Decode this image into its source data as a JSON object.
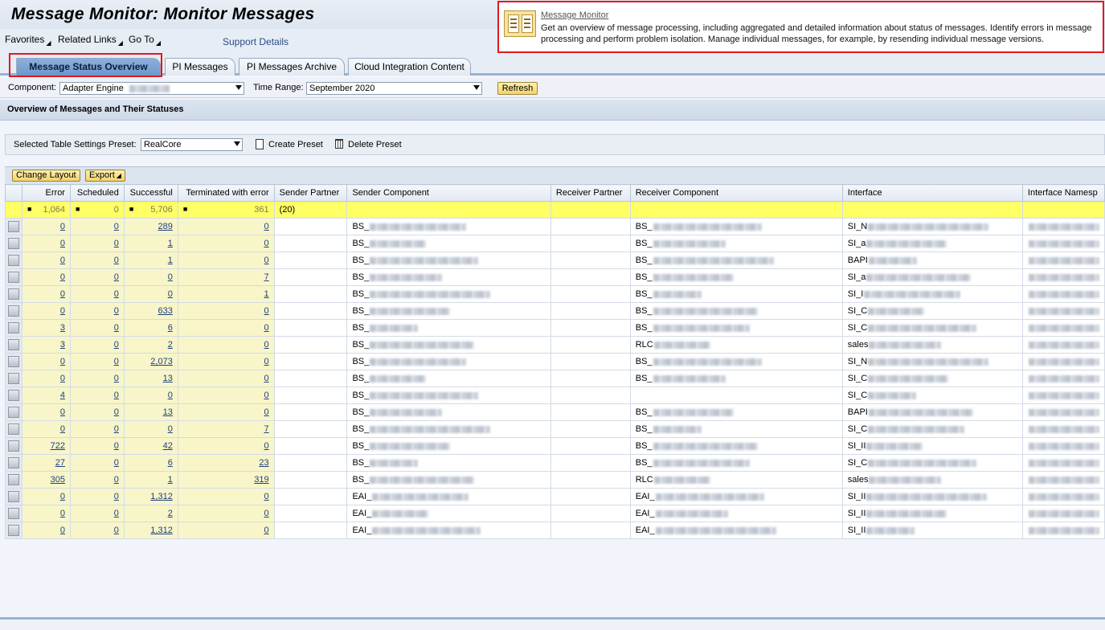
{
  "title": "Message Monitor: Monitor Messages",
  "menu": {
    "favorites": "Favorites",
    "related_links": "Related Links",
    "go_to": "Go To",
    "support": "Support Details"
  },
  "info": {
    "link": "Message Monitor",
    "text": "Get an overview of message processing, including aggregated and detailed information about status of messages. Identify errors in message processing and perform problem isolation. Manage individual messages, for example, by resending individual message versions."
  },
  "tabs": [
    "Message Status Overview",
    "PI Messages",
    "PI Messages Archive",
    "Cloud Integration Content"
  ],
  "filter": {
    "component_label": "Component:",
    "component_value": "Adapter Engine",
    "time_label": "Time Range:",
    "time_value": "September 2020",
    "refresh": "Refresh"
  },
  "section_title": "Overview of Messages and Their Statuses",
  "preset": {
    "label": "Selected Table Settings Preset:",
    "value": "RealCore",
    "create": "Create Preset",
    "delete": "Delete Preset"
  },
  "toolbar": {
    "change_layout": "Change Layout",
    "export": "Export"
  },
  "columns": [
    "Error",
    "Scheduled",
    "Successful",
    "Terminated with error",
    "Sender Partner",
    "Sender Component",
    "Receiver Partner",
    "Receiver Component",
    "Interface",
    "Interface Namesp"
  ],
  "totals": {
    "error": "1,064",
    "scheduled": "0",
    "successful": "5,706",
    "terminated": "361",
    "sender_partner": "(20)"
  },
  "rows": [
    {
      "error": "0",
      "scheduled": "0",
      "successful": "289",
      "terminated": "0",
      "sender": "BS_",
      "receiver": "BS_",
      "interface": "SI_N"
    },
    {
      "error": "0",
      "scheduled": "0",
      "successful": "1",
      "terminated": "0",
      "sender": "BS_",
      "receiver": "BS_",
      "interface": "SI_a"
    },
    {
      "error": "0",
      "scheduled": "0",
      "successful": "1",
      "terminated": "0",
      "sender": "BS_",
      "receiver": "BS_",
      "interface": "BAPI"
    },
    {
      "error": "0",
      "scheduled": "0",
      "successful": "0",
      "terminated": "7",
      "sender": "BS_",
      "receiver": "BS_",
      "interface": "SI_a"
    },
    {
      "error": "0",
      "scheduled": "0",
      "successful": "0",
      "terminated": "1",
      "sender": "BS_",
      "receiver": "BS_",
      "interface": "SI_I"
    },
    {
      "error": "0",
      "scheduled": "0",
      "successful": "633",
      "terminated": "0",
      "sender": "BS_",
      "receiver": "BS_",
      "interface": "SI_C"
    },
    {
      "error": "3",
      "scheduled": "0",
      "successful": "6",
      "terminated": "0",
      "sender": "BS_",
      "receiver": "BS_",
      "interface": "SI_C"
    },
    {
      "error": "3",
      "scheduled": "0",
      "successful": "2",
      "terminated": "0",
      "sender": "BS_",
      "receiver": "RLC",
      "interface": "sales"
    },
    {
      "error": "0",
      "scheduled": "0",
      "successful": "2,073",
      "terminated": "0",
      "sender": "BS_",
      "receiver": "BS_",
      "interface": "SI_N"
    },
    {
      "error": "0",
      "scheduled": "0",
      "successful": "13",
      "terminated": "0",
      "sender": "BS_",
      "receiver": "BS_",
      "interface": "SI_C"
    },
    {
      "error": "4",
      "scheduled": "0",
      "successful": "0",
      "terminated": "0",
      "sender": "BS_",
      "receiver": "",
      "interface": "SI_C"
    },
    {
      "error": "0",
      "scheduled": "0",
      "successful": "13",
      "terminated": "0",
      "sender": "BS_",
      "receiver": "BS_",
      "interface": "BAPI"
    },
    {
      "error": "0",
      "scheduled": "0",
      "successful": "0",
      "terminated": "7",
      "sender": "BS_",
      "receiver": "BS_",
      "interface": "SI_C"
    },
    {
      "error": "722",
      "scheduled": "0",
      "successful": "42",
      "terminated": "0",
      "sender": "BS_",
      "receiver": "BS_",
      "interface": "SI_II"
    },
    {
      "error": "27",
      "scheduled": "0",
      "successful": "6",
      "terminated": "23",
      "sender": "BS_",
      "receiver": "BS_",
      "interface": "SI_C"
    },
    {
      "error": "305",
      "scheduled": "0",
      "successful": "1",
      "terminated": "319",
      "sender": "BS_",
      "receiver": "RLC",
      "interface": "sales"
    },
    {
      "error": "0",
      "scheduled": "0",
      "successful": "1,312",
      "terminated": "0",
      "sender": "EAI_",
      "receiver": "EAI_",
      "interface": "SI_II"
    },
    {
      "error": "0",
      "scheduled": "0",
      "successful": "2",
      "terminated": "0",
      "sender": "EAI_",
      "receiver": "EAI_",
      "interface": "SI_II"
    },
    {
      "error": "0",
      "scheduled": "0",
      "successful": "1,312",
      "terminated": "0",
      "sender": "EAI_",
      "receiver": "EAI_",
      "interface": "SI_II"
    }
  ],
  "colors": {
    "highlight_border": "#e0191f",
    "total_row": "#ffff66",
    "numeric_cell": "#f8f6c8",
    "active_tab": "#7aa2d5",
    "button": "#f3d36e"
  }
}
